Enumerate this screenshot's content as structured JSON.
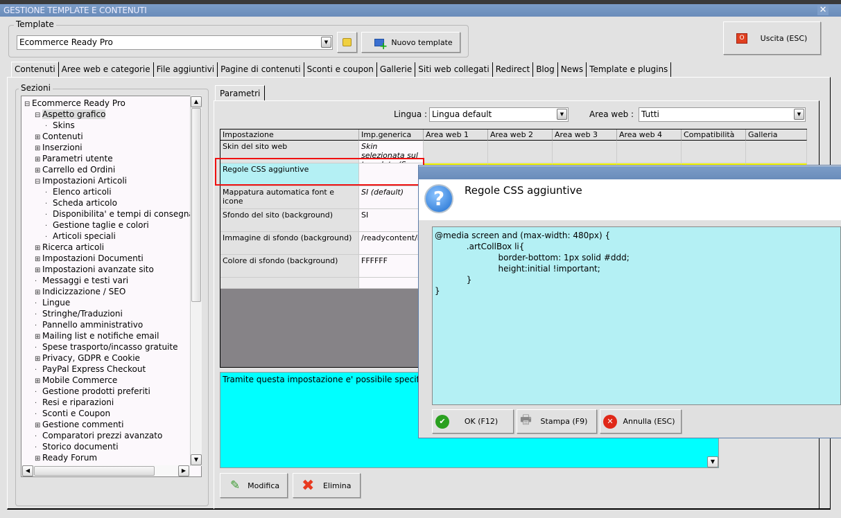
{
  "window": {
    "title": "GESTIONE TEMPLATE E CONTENUTI",
    "close": "✕"
  },
  "template": {
    "group_label": "Template",
    "selected": "Ecommerce Ready Pro",
    "new_button": "Nuovo template"
  },
  "exit_button": "Uscita (ESC)",
  "tabs": [
    "Contenuti",
    "Aree web e categorie",
    "File aggiuntivi",
    "Pagine di contenuti",
    "Sconti e coupon",
    "Gallerie",
    "Siti web collegati",
    "Redirect",
    "Blog",
    "News",
    "Template e plugins"
  ],
  "sections": {
    "label": "Sezioni",
    "items": [
      {
        "label": "Ecommerce Ready Pro",
        "level": 0,
        "exp": "−"
      },
      {
        "label": "Aspetto grafico",
        "level": 1,
        "exp": "−",
        "selected": true
      },
      {
        "label": "Skins",
        "level": 2,
        "exp": ""
      },
      {
        "label": "Contenuti",
        "level": 1,
        "exp": "+"
      },
      {
        "label": "Inserzioni",
        "level": 1,
        "exp": "+"
      },
      {
        "label": "Parametri utente",
        "level": 1,
        "exp": "+"
      },
      {
        "label": "Carrello ed Ordini",
        "level": 1,
        "exp": "+"
      },
      {
        "label": "Impostazioni Articoli",
        "level": 1,
        "exp": "−"
      },
      {
        "label": "Elenco articoli",
        "level": 2,
        "exp": ""
      },
      {
        "label": "Scheda articolo",
        "level": 2,
        "exp": ""
      },
      {
        "label": "Disponibilita' e tempi di consegna",
        "level": 2,
        "exp": ""
      },
      {
        "label": "Gestione taglie e colori",
        "level": 2,
        "exp": ""
      },
      {
        "label": "Articoli speciali",
        "level": 2,
        "exp": ""
      },
      {
        "label": "Ricerca articoli",
        "level": 1,
        "exp": "+"
      },
      {
        "label": "Impostazioni Documenti",
        "level": 1,
        "exp": "+"
      },
      {
        "label": "Impostazioni avanzate sito",
        "level": 1,
        "exp": "+"
      },
      {
        "label": "Messaggi e testi vari",
        "level": 1,
        "exp": ""
      },
      {
        "label": "Indicizzazione / SEO",
        "level": 1,
        "exp": "+"
      },
      {
        "label": "Lingue",
        "level": 1,
        "exp": ""
      },
      {
        "label": "Stringhe/Traduzioni",
        "level": 1,
        "exp": ""
      },
      {
        "label": "Pannello amministrativo",
        "level": 1,
        "exp": ""
      },
      {
        "label": "Mailing list e notifiche email",
        "level": 1,
        "exp": "+"
      },
      {
        "label": "Spese trasporto/incasso gratuite",
        "level": 1,
        "exp": ""
      },
      {
        "label": "Privacy, GDPR e Cookie",
        "level": 1,
        "exp": "+"
      },
      {
        "label": "PayPal Express Checkout",
        "level": 1,
        "exp": ""
      },
      {
        "label": "Mobile Commerce",
        "level": 1,
        "exp": "+"
      },
      {
        "label": "Gestione prodotti preferiti",
        "level": 1,
        "exp": ""
      },
      {
        "label": "Resi e riparazioni",
        "level": 1,
        "exp": ""
      },
      {
        "label": "Sconti e Coupon",
        "level": 1,
        "exp": ""
      },
      {
        "label": "Gestione commenti",
        "level": 1,
        "exp": "+"
      },
      {
        "label": "Comparatori prezzi avanzato",
        "level": 1,
        "exp": ""
      },
      {
        "label": "Storico documenti",
        "level": 1,
        "exp": ""
      },
      {
        "label": "Ready Forum",
        "level": 1,
        "exp": "+"
      }
    ]
  },
  "params": {
    "tab": "Parametri",
    "lingua_label": "Lingua :",
    "lingua_value": "Lingua default",
    "area_label": "Area web :",
    "area_value": "Tutti",
    "columns": [
      "Impostazione",
      "Imp.generica",
      "Area web 1",
      "Area web 2",
      "Area web 3",
      "Area web 4",
      "Compatibilità",
      "Galleria"
    ],
    "rows": [
      {
        "name": "Skin del sito web",
        "value": "Skin selezionata sul template (S...",
        "italic": true
      },
      {
        "name": "Regole CSS aggiuntive",
        "value": "",
        "selected": true
      },
      {
        "name": "Mappatura automatica font e icone",
        "value": "SI (default)",
        "italic": true
      },
      {
        "name": "Sfondo del sito (background)",
        "value": "SI"
      },
      {
        "name": "Immagine di sfondo (background)",
        "value": "/readycontent/images/christmas..."
      },
      {
        "name": "Colore di sfondo (background)",
        "value": "FFFFFF"
      }
    ],
    "description": "Tramite questa impostazione e' possibile specificare",
    "edit_button": "Modifica",
    "delete_button": "Elimina"
  },
  "dialog": {
    "title": "Regole CSS aggiuntive",
    "code": "@media screen and (max-width: 480px) {\n            .artCollBox li{\n                        border-bottom: 1px solid #ddd;\n                        height:initial !important;\n            }\n}",
    "ok": "OK (F12)",
    "print": "Stampa (F9)",
    "cancel": "Annulla (ESC)"
  },
  "colors": {
    "titlebar": "#6f93c0",
    "selected_cell": "#b4f0f4",
    "description_bg": "#00ffff",
    "highlight": "#ff0000"
  }
}
